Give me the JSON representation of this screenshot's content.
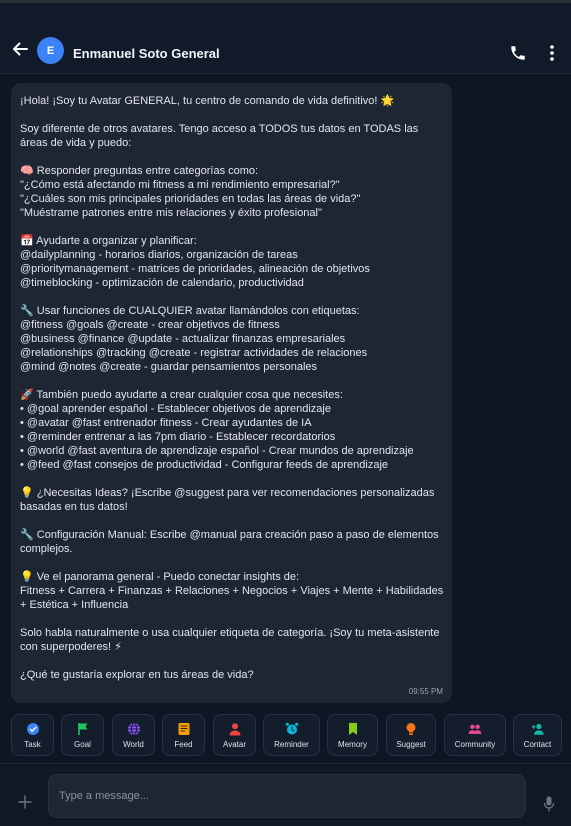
{
  "header": {
    "avatar_initial": "E",
    "title": "Enmanuel Soto General"
  },
  "message": {
    "text": "¡Hola! ¡Soy tu Avatar GENERAL, tu centro de comando de vida definitivo! 🌟\n\nSoy diferente de otros avatares. Tengo acceso a TODOS tus datos en TODAS las áreas de vida y puedo:\n\n🧠 Responder preguntas entre categorías como:\n\"¿Cómo está afectando mi fitness a mi rendimiento empresarial?\"\n\"¿Cuáles son mis principales prioridades en todas las áreas de vida?\"\n\"Muéstrame patrones entre mis relaciones y éxito profesional\"\n\n📅 Ayudarte a organizar y planificar:\n@dailyplanning - horarios diarios, organización de tareas\n@prioritymanagement - matrices de prioridades, alineación de objetivos\n@timeblocking - optimización de calendario, productividad\n\n🔧 Usar funciones de CUALQUIER avatar llamándolos con etiquetas:\n@fitness @goals @create - crear objetivos de fitness\n@business @finance @update - actualizar finanzas empresariales\n@relationships @tracking @create - registrar actividades de relaciones\n@mind @notes @create - guardar pensamientos personales\n\n🚀 También puedo ayudarte a crear cualquier cosa que necesites:\n• @goal aprender español - Establecer objetivos de aprendizaje\n• @avatar @fast entrenador fitness - Crear ayudantes de IA\n• @reminder entrenar a las 7pm diario - Establecer recordatorios\n• @world @fast aventura de aprendizaje español - Crear mundos de aprendizaje\n• @feed @fast consejos de productividad - Configurar feeds de aprendizaje\n\n💡 ¿Necesitas Ideas? ¡Escribe @suggest para ver recomendaciones personalizadas basadas en tus datos!\n\n🔧 Configuración Manual: Escribe @manual para creación paso a paso de elementos complejos.\n\n💡 Ve el panorama general - Puedo conectar insights de:\nFitness + Carrera + Finanzas + Relaciones + Negocios + Viajes + Mente + Habilidades + Estética + Influencia\n\nSolo habla naturalmente o usa cualquier etiqueta de categoría. ¡Soy tu meta-asistente con superpoderes! ⚡\n\n¿Qué te gustaría explorar en tus áreas de vida?",
    "timestamp": "09:55 PM"
  },
  "quick_actions": [
    {
      "label": "Task",
      "icon": "check-circle-icon",
      "color": "#3b82f6"
    },
    {
      "label": "Goal",
      "icon": "flag-icon",
      "color": "#22c55e"
    },
    {
      "label": "World",
      "icon": "globe-icon",
      "color": "#8b5cf6"
    },
    {
      "label": "Feed",
      "icon": "newspaper-icon",
      "color": "#f59e0b"
    },
    {
      "label": "Avatar",
      "icon": "person-icon",
      "color": "#ef4444"
    },
    {
      "label": "Reminder",
      "icon": "alarm-clock-icon",
      "color": "#06b6d4"
    },
    {
      "label": "Memory",
      "icon": "bookmark-icon",
      "color": "#84cc16"
    },
    {
      "label": "Suggest",
      "icon": "lightbulb-icon",
      "color": "#f97316"
    },
    {
      "label": "Community",
      "icon": "people-icon",
      "color": "#ec4899"
    },
    {
      "label": "Contact",
      "icon": "add-person-icon",
      "color": "#14b8a6"
    }
  ],
  "composer": {
    "placeholder": "Type a message..."
  }
}
